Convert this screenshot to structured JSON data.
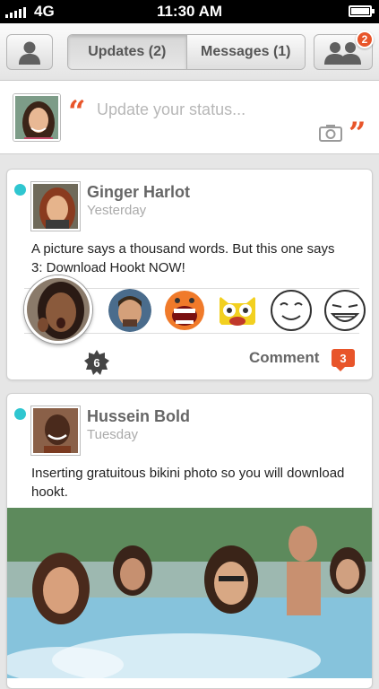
{
  "status_bar": {
    "network": "4G",
    "time": "11:30 AM"
  },
  "nav": {
    "tabs": [
      {
        "label": "Updates (2)",
        "active": true
      },
      {
        "label": "Messages (1)",
        "active": false
      }
    ],
    "friends_badge": "2"
  },
  "status_update": {
    "placeholder": "Update your status...",
    "open_quote": "“",
    "close_quote": "”"
  },
  "posts": [
    {
      "author": "Ginger Harlot",
      "time": "Yesterday",
      "text": "A picture says a thousand words. But this one says 3: Download Hookt NOW!",
      "reaction_count": "6",
      "comment_label": "Comment",
      "comment_count": "3"
    },
    {
      "author": "Hussein Bold",
      "time": "Tuesday",
      "text": "Inserting gratuitous bikini photo so you will download hookt."
    }
  ],
  "colors": {
    "accent": "#e8552a",
    "online": "#2fc6d0"
  }
}
